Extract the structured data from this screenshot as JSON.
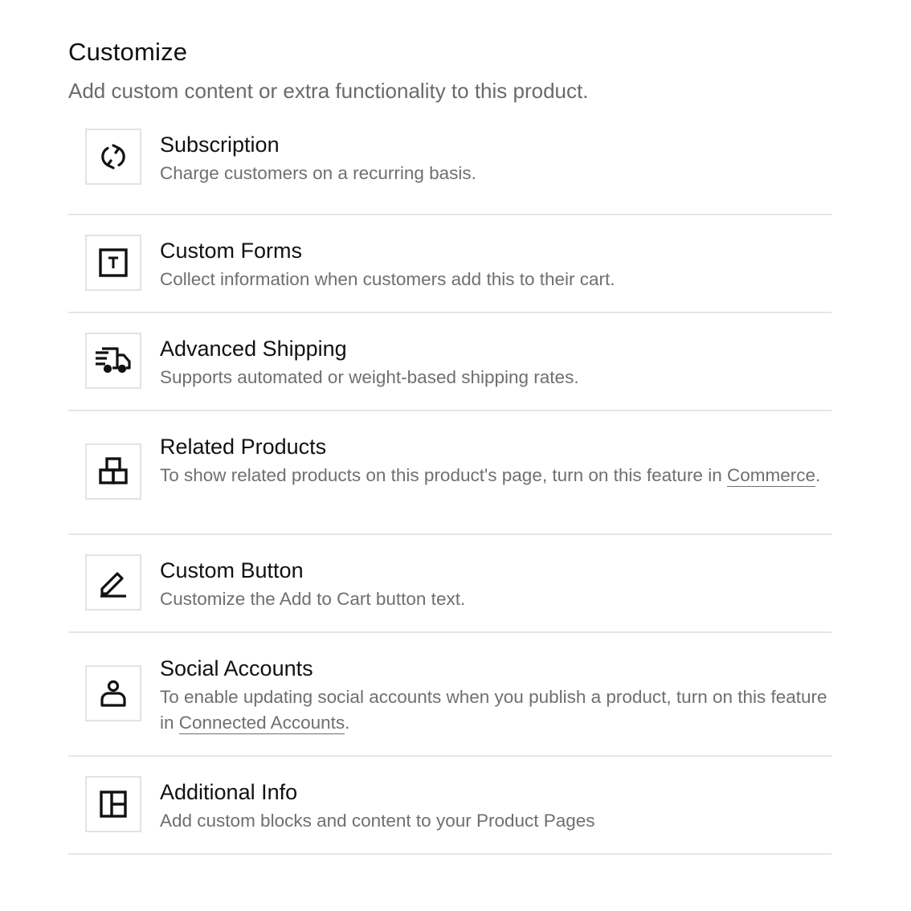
{
  "header": {
    "title": "Customize",
    "subtitle": "Add custom content or extra functionality to this product."
  },
  "items": [
    {
      "title": "Subscription",
      "desc": "Charge customers on a recurring basis.",
      "icon": "recurring-arrows-icon"
    },
    {
      "title": "Custom Forms",
      "desc": "Collect information when customers add this to their cart.",
      "icon": "text-box-icon"
    },
    {
      "title": "Advanced Shipping",
      "desc": "Supports automated or weight-based shipping rates.",
      "icon": "truck-icon"
    },
    {
      "title": "Related Products",
      "desc_before": "To show related products on this product's page, turn on this feature in ",
      "link": "Commerce",
      "desc_after": ".",
      "icon": "boxes-icon"
    },
    {
      "title": "Custom Button",
      "desc": "Customize the Add to Cart button text.",
      "icon": "pencil-icon"
    },
    {
      "title": "Social Accounts",
      "desc_before": "To enable updating social accounts when you publish a product, turn on this feature in ",
      "link": "Connected Accounts",
      "desc_after": ".",
      "icon": "person-icon"
    },
    {
      "title": "Additional Info",
      "desc": "Add custom blocks and content to your Product Pages",
      "icon": "layout-icon"
    }
  ]
}
